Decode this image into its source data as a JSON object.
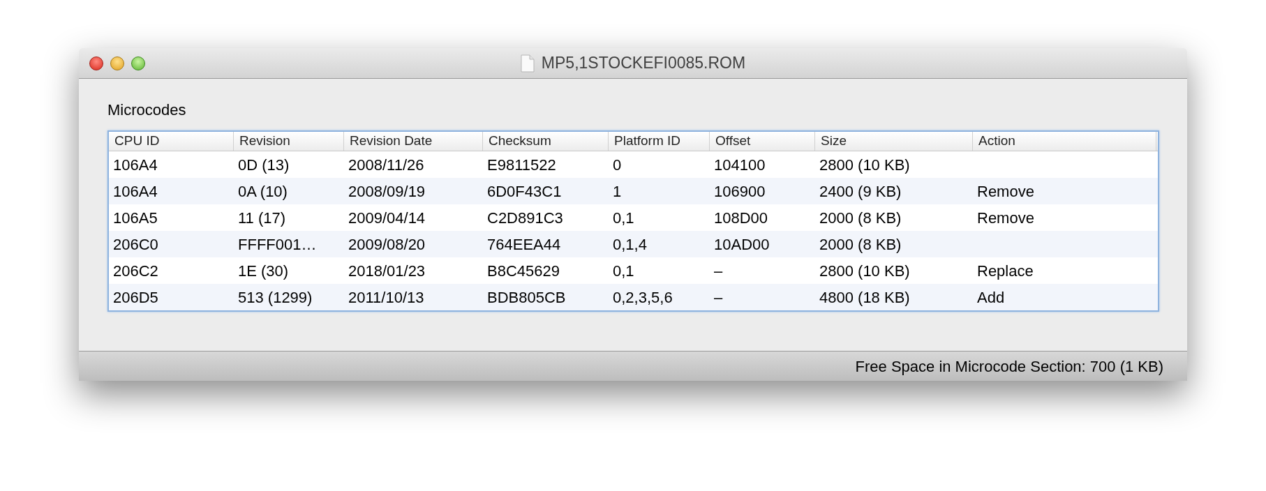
{
  "window": {
    "title": "MP5,1STOCKEFI0085.ROM"
  },
  "section_label": "Microcodes",
  "table": {
    "columns": [
      "CPU ID",
      "Revision",
      "Revision Date",
      "Checksum",
      "Platform ID",
      "Offset",
      "Size",
      "Action"
    ],
    "rows": [
      [
        "106A4",
        "0D (13)",
        "2008/11/26",
        "E9811522",
        "0",
        "104100",
        "2800 (10 KB)",
        ""
      ],
      [
        "106A4",
        "0A (10)",
        "2008/09/19",
        "6D0F43C1",
        "1",
        "106900",
        "2400 (9 KB)",
        "Remove"
      ],
      [
        "106A5",
        "11 (17)",
        "2009/04/14",
        "C2D891C3",
        "0,1",
        "108D00",
        "2000 (8 KB)",
        "Remove"
      ],
      [
        "206C0",
        "FFFF001…",
        "2009/08/20",
        "764EEA44",
        "0,1,4",
        "10AD00",
        "2000 (8 KB)",
        ""
      ],
      [
        "206C2",
        "1E (30)",
        "2018/01/23",
        "B8C45629",
        "0,1",
        "–",
        "2800 (10 KB)",
        "Replace"
      ],
      [
        "206D5",
        "513 (1299)",
        "2011/10/13",
        "BDB805CB",
        "0,2,3,5,6",
        "–",
        "4800 (18 KB)",
        "Add"
      ]
    ]
  },
  "status_bar": "Free Space in Microcode Section: 700 (1 KB)"
}
